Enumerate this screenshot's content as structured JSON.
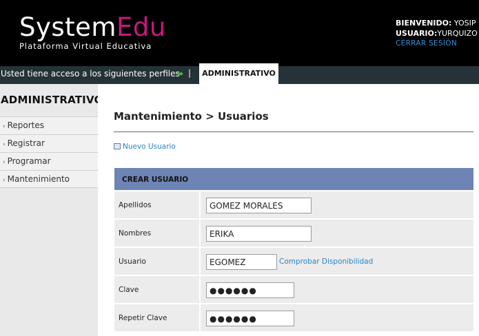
{
  "header": {
    "logo_main": "System",
    "logo_accent": "Edu",
    "tagline": "Plataforma Virtual Educativa",
    "welcome_label": "BIENVENIDO:",
    "welcome_value": "YOSIP",
    "user_label": "USUARIO:",
    "user_value": "YURQUIZO",
    "logout": "CERRAR SESIÓN"
  },
  "profilebar": {
    "message": "Usted tiene acceso a los siguientes perfiles",
    "separator": "|",
    "active_profile": "ADMINISTRATIVO"
  },
  "sidebar": {
    "title": "ADMINISTRATIVO",
    "items": [
      {
        "label": "Reportes"
      },
      {
        "label": "Registrar"
      },
      {
        "label": "Programar"
      },
      {
        "label": "Mantenimiento"
      }
    ]
  },
  "main": {
    "title": "Mantenimiento > Usuarios",
    "new_user_link": "Nuevo Usuario",
    "form": {
      "header": "CREAR USUARIO",
      "fields": [
        {
          "label": "Apellidos",
          "value": "GOMEZ MORALES"
        },
        {
          "label": "Nombres",
          "value": "ERIKA"
        },
        {
          "label": "Usuario",
          "value": "EGOMEZ"
        },
        {
          "label": "Clave",
          "value": "●●●●●●"
        },
        {
          "label": "Repetir Clave",
          "value": "●●●●●●"
        }
      ],
      "check_link": "Comprobar Disponibilidad"
    }
  },
  "colors": {
    "header_bg": "#000000",
    "logo_accent": "#c5187f",
    "link": "#2a84c6",
    "profilebar_bg": "#253237",
    "form_header_bg": "#6d84b4",
    "arrow": "#3fbf3a"
  },
  "icons": {
    "profile_arrow": "right-arrow-icon",
    "new_user": "document-icon",
    "sidebar_bullet": "arrow-bullet-icon"
  }
}
